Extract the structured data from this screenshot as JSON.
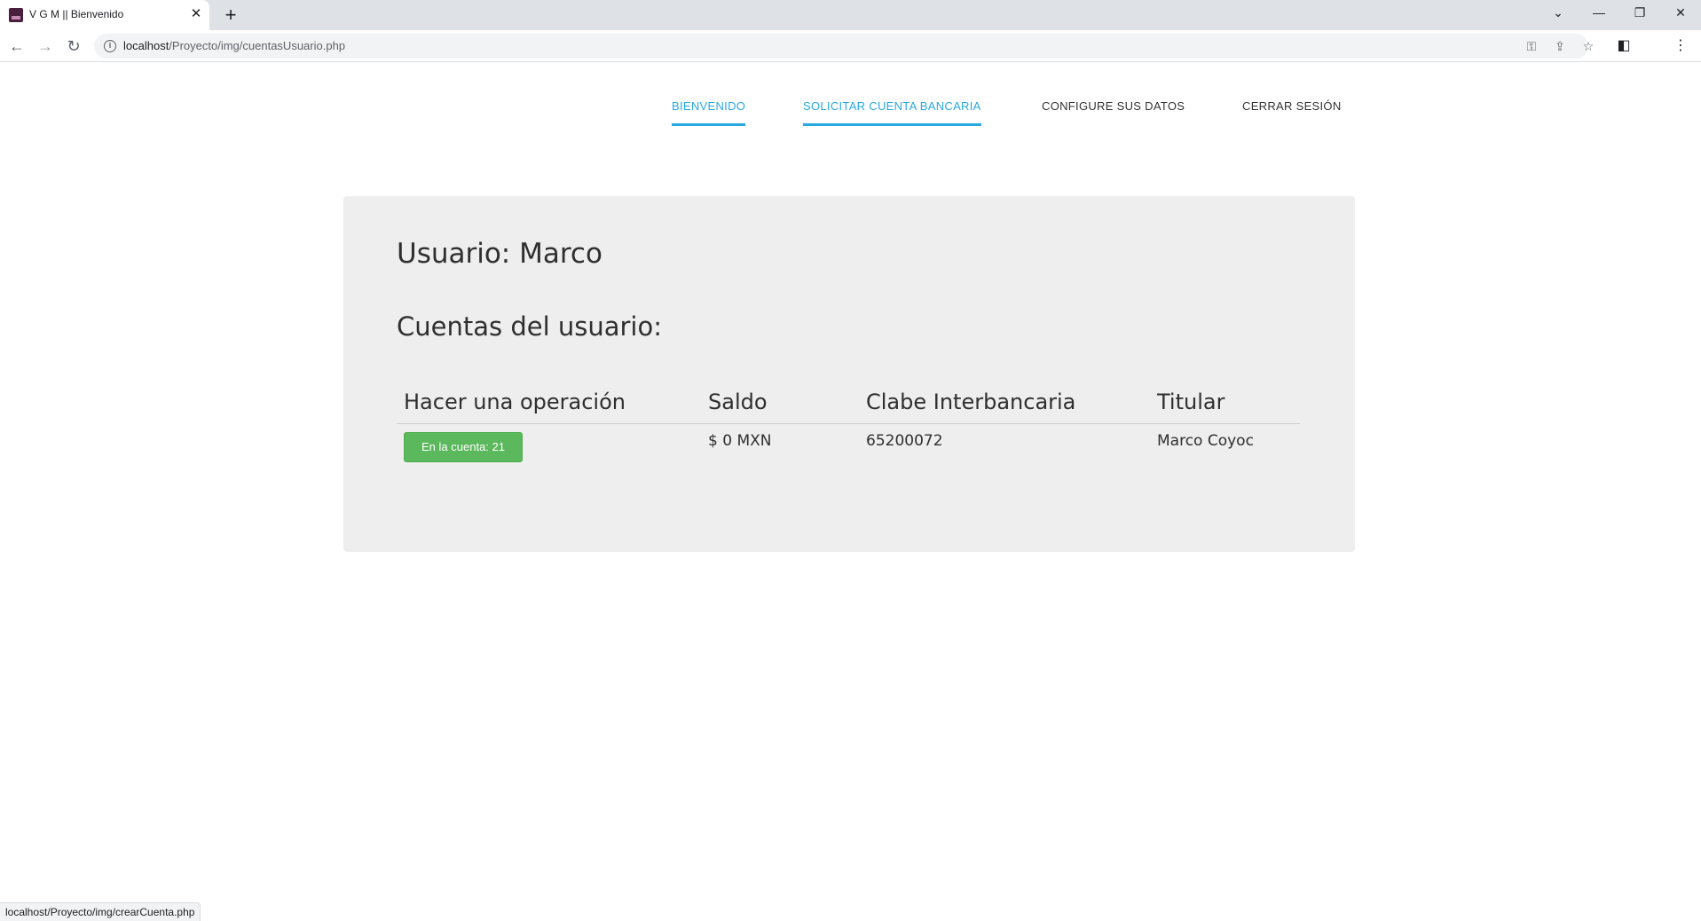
{
  "browser": {
    "tab_title": "V G M || Bienvenido",
    "tab_close": "✕",
    "new_tab": "+",
    "url_host": "localhost",
    "url_path": "/Proyecto/img/cuentasUsuario.php",
    "status_url": "localhost/Proyecto/img/crearCuenta.php"
  },
  "nav": {
    "items": [
      {
        "label": "BIENVENIDO",
        "active": true
      },
      {
        "label": "SOLICITAR CUENTA BANCARIA",
        "active": true
      },
      {
        "label": "CONFIGURE SUS DATOS",
        "active": false
      },
      {
        "label": "CERRAR SESIÓN",
        "active": false
      }
    ]
  },
  "content": {
    "user_heading": "Usuario: Marco",
    "accounts_heading": "Cuentas del usuario:"
  },
  "table": {
    "headers": [
      "Hacer una operación",
      "Saldo",
      "Clabe Interbancaria",
      "Titular"
    ],
    "rows": [
      {
        "operation_button": "En la cuenta: 21",
        "saldo": "$ 0 MXN",
        "clabe": "65200072",
        "titular": "Marco Coyoc"
      }
    ]
  },
  "colors": {
    "accent": "#29a8e0",
    "button_green": "#5cb85c",
    "card_bg": "#eeeeee"
  }
}
